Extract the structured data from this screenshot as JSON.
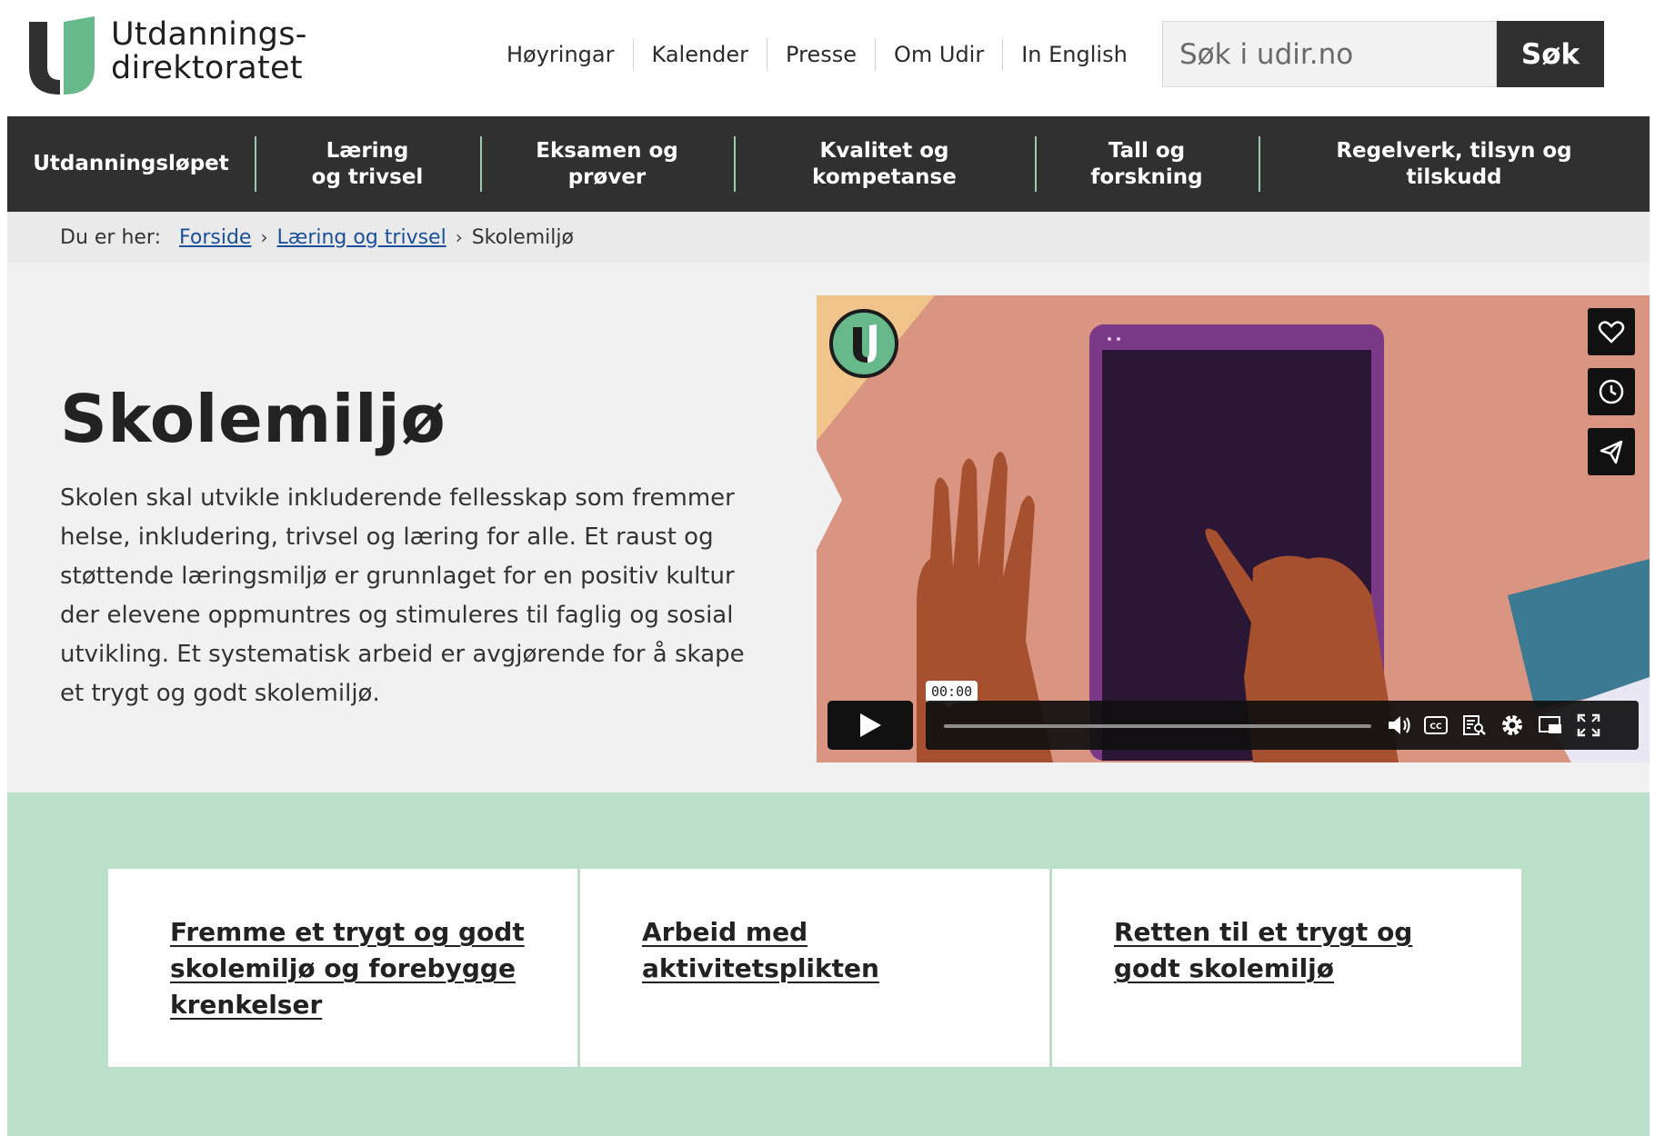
{
  "logo": {
    "line1": "Utdannings-",
    "line2": "direktoratet",
    "icon": "udir-logo-mark",
    "colors": {
      "dark": "#303030",
      "green": "#67b88a"
    }
  },
  "util_nav": [
    "Høyringar",
    "Kalender",
    "Presse",
    "Om Udir",
    "In English"
  ],
  "search": {
    "placeholder": "Søk i udir.no",
    "button_label": "Søk"
  },
  "main_nav": [
    "Utdanningsløpet",
    "Læring og trivsel",
    "Eksamen og prøver",
    "Kvalitet og kompetanse",
    "Tall og forskning",
    "Regelverk, tilsyn og tilskudd"
  ],
  "breadcrumb": {
    "prefix": "Du er her:",
    "items": [
      "Forside",
      "Læring og trivsel"
    ],
    "current": "Skolemiljø"
  },
  "hero": {
    "title": "Skolemiljø",
    "text": "Skolen skal utvikle inkluderende fellesskap som fremmer helse, inkludering, trivsel og læring for alle. Et raust og støttende læringsmiljø er grunnlaget for en positiv kultur der elevene oppmuntres og stimuleres til faglig og sosial utvikling. Et systematisk arbeid er avgjørende for å skape et trygt og godt skolemiljø."
  },
  "video": {
    "time": "00:00",
    "progress": 0,
    "side_buttons": [
      "heart-icon",
      "clock-icon",
      "share-icon"
    ],
    "controls": [
      "volume-icon",
      "captions-icon",
      "transcript-icon",
      "settings-icon",
      "picture-in-picture-icon",
      "fullscreen-icon"
    ]
  },
  "cards": [
    "Fremme et trygt og godt skolemiljø og forebygge krenkelser",
    "Arbeid med aktivitetsplikten",
    "Retten til et trygt og godt skolemiljø"
  ],
  "colors": {
    "nav_bg": "#303030",
    "nav_divider": "#9ec9ae",
    "link_blue": "#1a4f9c",
    "hero_bg": "#f1f1f1",
    "green_section": "#bae0ca",
    "breadcrumb_bg": "#eaeaea"
  }
}
